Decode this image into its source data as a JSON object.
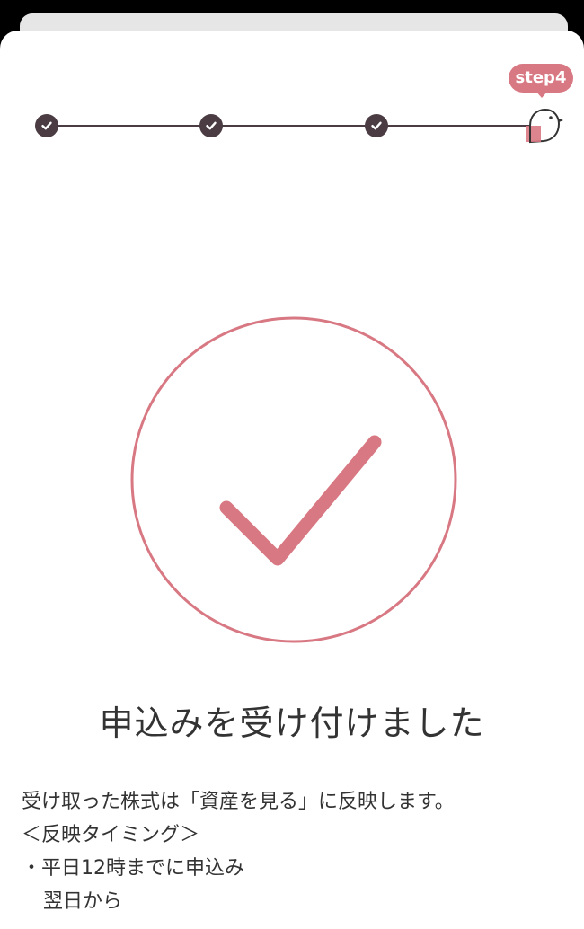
{
  "stepper": {
    "badge_label": "step4",
    "completed_icon": "check-icon",
    "current_icon": "bird-icon"
  },
  "main": {
    "success_icon": "check-circle-icon",
    "title": "申込みを受け付けました",
    "message_lines": [
      "受け取った株式は「資産を見る」に反映します。",
      "＜反映タイミング＞",
      "・平日12時までに申込み",
      "翌日から"
    ]
  },
  "colors": {
    "accent": "#d87883",
    "dark": "#4b3c43",
    "text": "#333333"
  }
}
